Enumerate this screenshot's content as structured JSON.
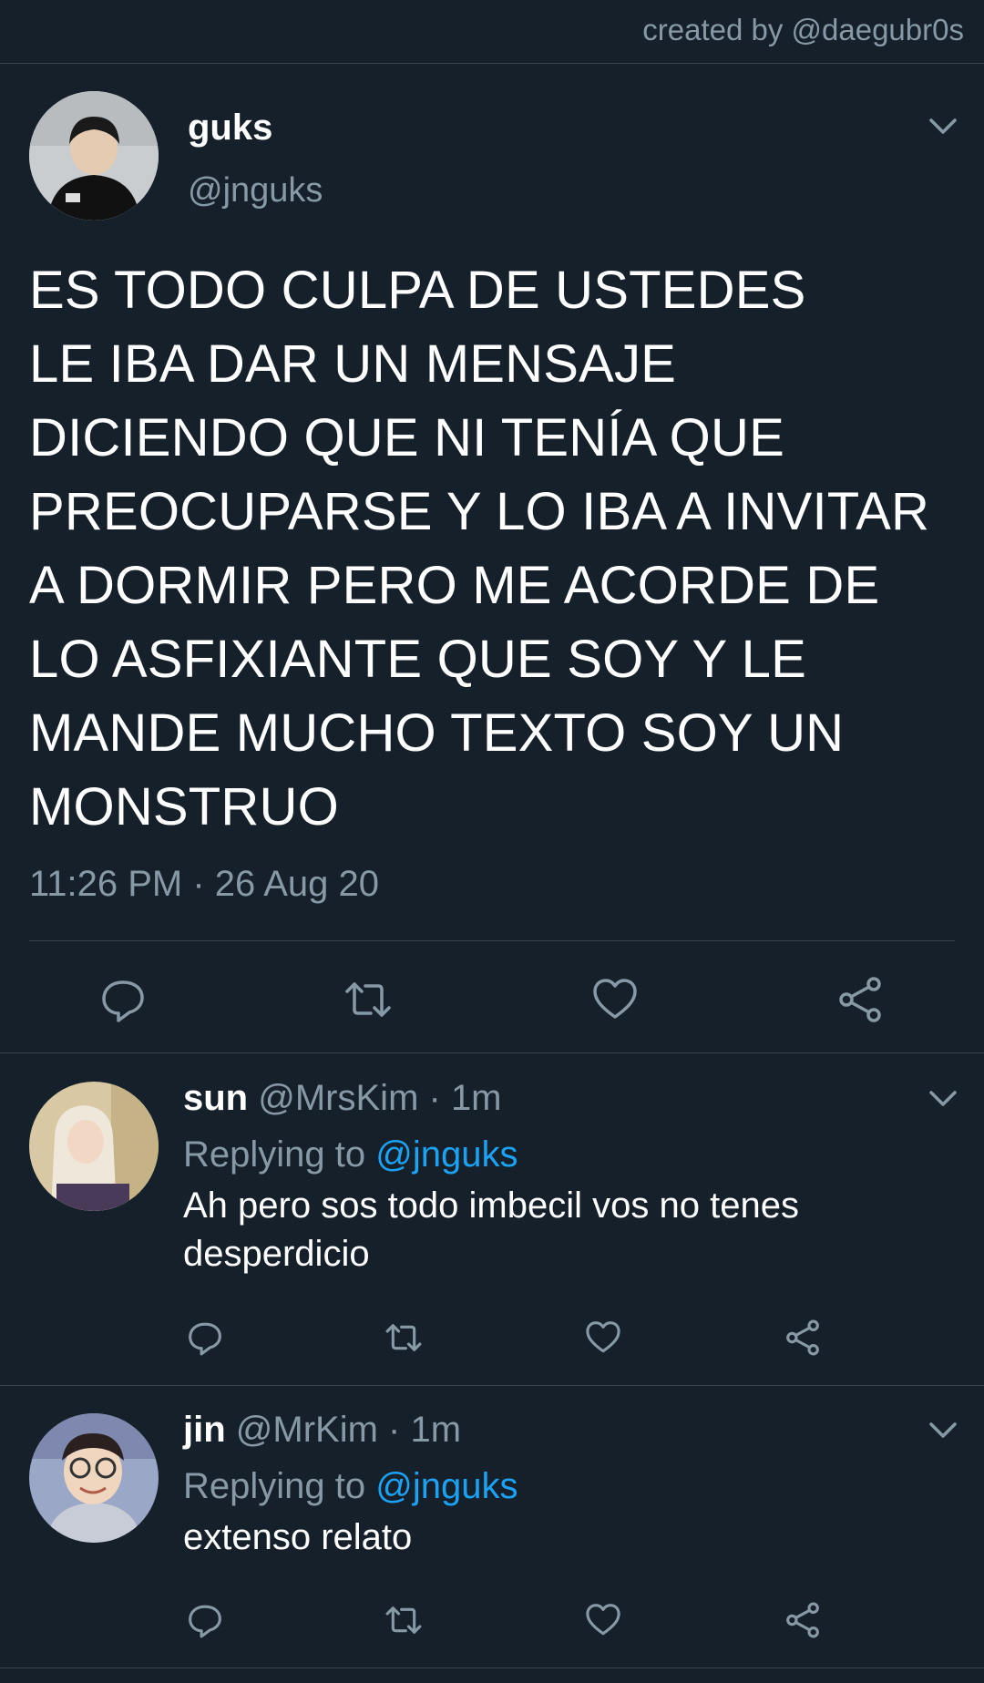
{
  "credit": "created by @daegubr0s",
  "main_tweet": {
    "display_name": "guks",
    "handle": "@jnguks",
    "text": "ES TODO CULPA DE USTEDES\nLE IBA DAR UN MENSAJE\nDICIENDO QUE NI TENÍA QUE\nPREOCUPARSE Y LO IBA A INVITAR\nA DORMIR PERO ME ACORDE DE\nLO ASFIXIANTE QUE SOY Y LE\nMANDE MUCHO TEXTO SOY UN\nMONSTRUO",
    "timestamp": "11:26 PM · 26 Aug 20",
    "actions": [
      "reply-icon",
      "retweet-icon",
      "like-icon",
      "share-icon"
    ]
  },
  "replies": [
    {
      "display_name": "sun",
      "handle": "@MrsKim",
      "time": " · 1m",
      "replying_label": "Replying to ",
      "replying_to": "@jnguks",
      "text": "Ah pero sos todo imbecil vos no tenes desperdicio"
    },
    {
      "display_name": "jin",
      "handle": "@MrKim",
      "time": " · 1m",
      "replying_label": "Replying to ",
      "replying_to": "@jnguks",
      "text": "extenso relato"
    }
  ],
  "colors": {
    "background": "#15202b",
    "divider": "#38444d",
    "secondary_text": "#8899a6",
    "link": "#1da1f2",
    "icon": "#8899a6"
  }
}
